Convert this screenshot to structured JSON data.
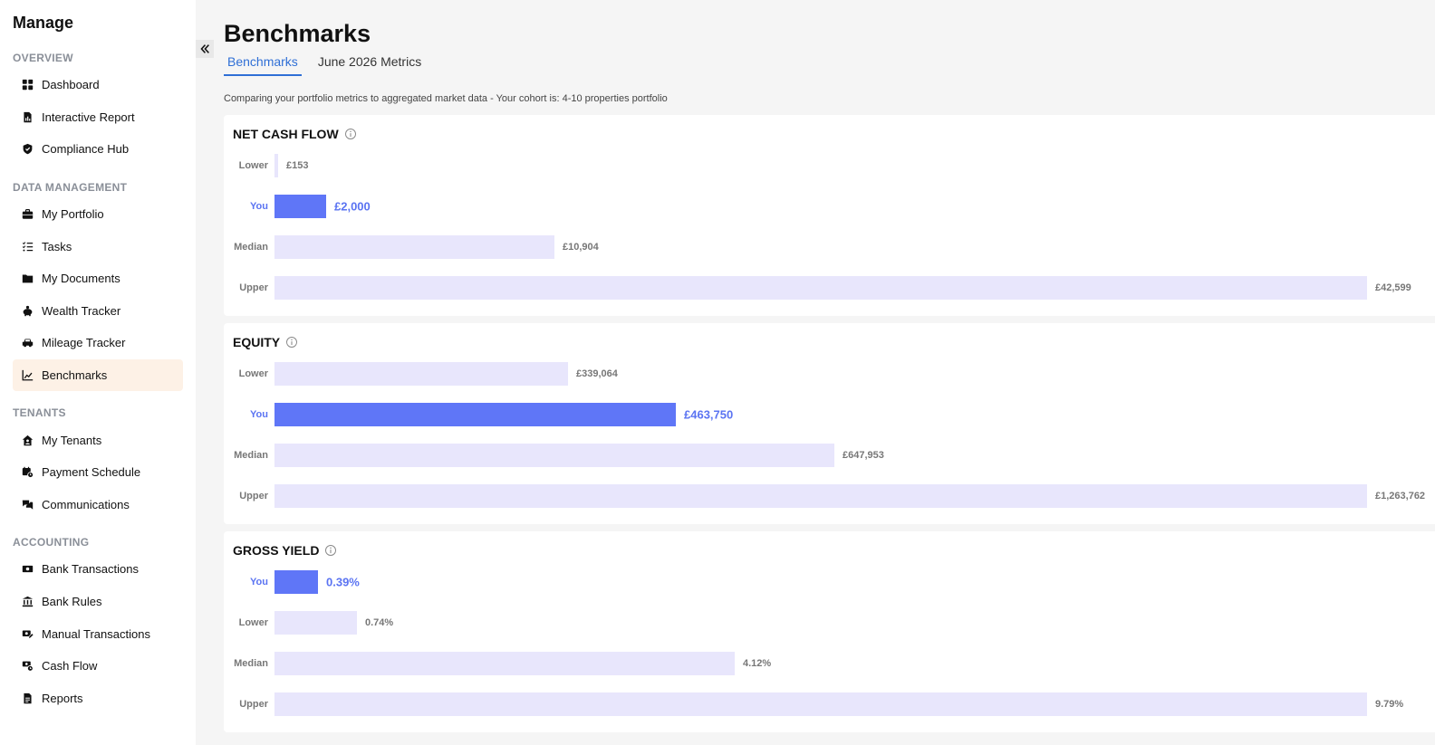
{
  "sidebar": {
    "title": "Manage",
    "sections": [
      {
        "heading": "OVERVIEW",
        "items": [
          {
            "label": "Dashboard",
            "icon": "grid-icon"
          },
          {
            "label": "Interactive Report",
            "icon": "report-icon"
          },
          {
            "label": "Compliance Hub",
            "icon": "shield-icon"
          }
        ]
      },
      {
        "heading": "DATA MANAGEMENT",
        "items": [
          {
            "label": "My Portfolio",
            "icon": "briefcase-icon"
          },
          {
            "label": "Tasks",
            "icon": "checklist-icon"
          },
          {
            "label": "My Documents",
            "icon": "folder-icon"
          },
          {
            "label": "Wealth Tracker",
            "icon": "piggy-bank-icon"
          },
          {
            "label": "Mileage Tracker",
            "icon": "car-icon"
          },
          {
            "label": "Benchmarks",
            "icon": "chart-icon",
            "active": true
          }
        ]
      },
      {
        "heading": "TENANTS",
        "items": [
          {
            "label": "My Tenants",
            "icon": "house-user-icon"
          },
          {
            "label": "Payment Schedule",
            "icon": "calendar-clock-icon"
          },
          {
            "label": "Communications",
            "icon": "chat-icon"
          }
        ]
      },
      {
        "heading": "ACCOUNTING",
        "items": [
          {
            "label": "Bank Transactions",
            "icon": "money-icon"
          },
          {
            "label": "Bank Rules",
            "icon": "bank-icon"
          },
          {
            "label": "Manual Transactions",
            "icon": "edit-money-icon"
          },
          {
            "label": "Cash Flow",
            "icon": "cash-flow-icon"
          },
          {
            "label": "Reports",
            "icon": "document-icon"
          }
        ]
      }
    ]
  },
  "header": {
    "title": "Benchmarks",
    "tabs": [
      {
        "label": "Benchmarks",
        "active": true
      },
      {
        "label": "June 2026 Metrics",
        "active": false
      }
    ],
    "subtitle": "Comparing your portfolio metrics to aggregated market data - Your cohort is: 4-10 properties portfolio"
  },
  "colors": {
    "accent": "#5f76f7",
    "bar": "#e8e6fc",
    "active_tab": "#2f6fd6",
    "active_nav": "#fdf1e6"
  },
  "chart_data": [
    {
      "type": "bar",
      "title": "NET CASH FLOW",
      "categories": [
        "Lower",
        "You",
        "Median",
        "Upper"
      ],
      "values": [
        153,
        2000,
        10904,
        42599
      ],
      "labels": [
        "£153",
        "£2,000",
        "£10,904",
        "£42,599"
      ],
      "highlight": "You",
      "xlim": [
        0,
        42599
      ]
    },
    {
      "type": "bar",
      "title": "EQUITY",
      "categories": [
        "Lower",
        "You",
        "Median",
        "Upper"
      ],
      "values": [
        339064,
        463750,
        647953,
        1263762
      ],
      "labels": [
        "£339,064",
        "£463,750",
        "£647,953",
        "£1,263,762"
      ],
      "highlight": "You",
      "xlim": [
        0,
        1263762
      ]
    },
    {
      "type": "bar",
      "title": "GROSS YIELD",
      "categories": [
        "You",
        "Lower",
        "Median",
        "Upper"
      ],
      "values": [
        0.39,
        0.74,
        4.12,
        9.79
      ],
      "labels": [
        "0.39%",
        "0.74%",
        "4.12%",
        "9.79%"
      ],
      "highlight": "You",
      "xlim": [
        0,
        9.79
      ]
    }
  ]
}
